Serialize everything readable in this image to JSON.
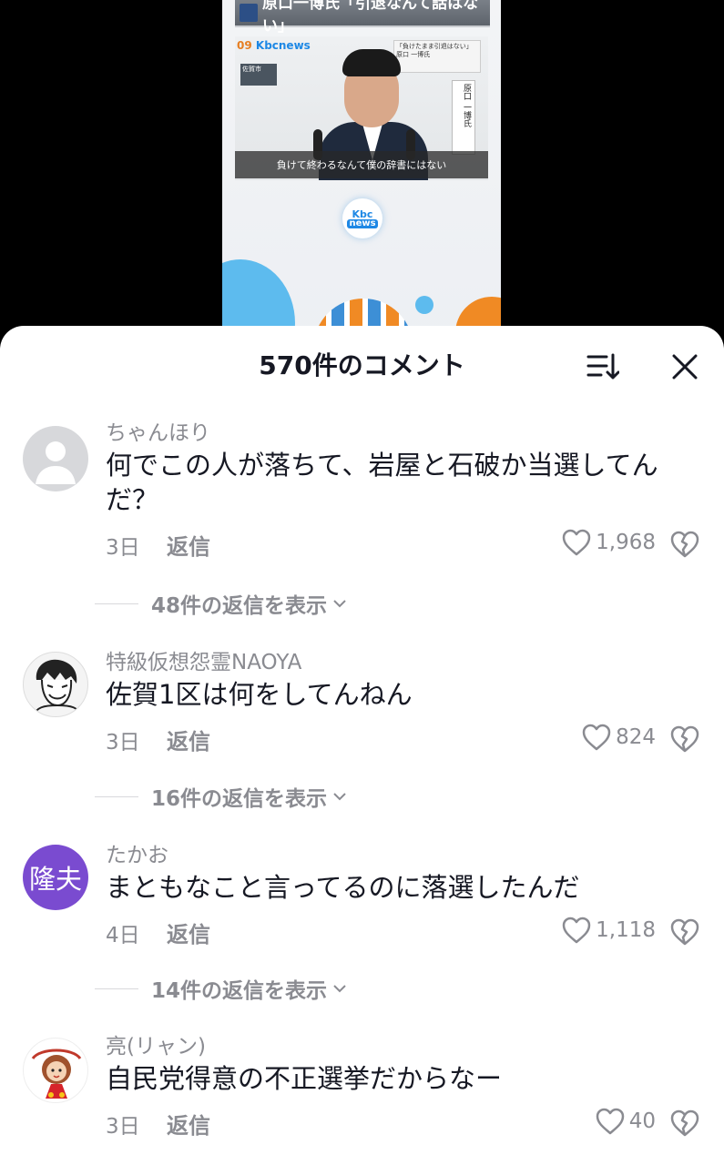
{
  "video": {
    "headline": "原口一博氏「引退なんて話はない」",
    "channel_num": "09",
    "channel_name": "Kbcnews",
    "caption_right": "「負けたまま引退はない」",
    "caption_right_sub": "原口 一博氏",
    "location": "佐賀市",
    "name_plate": "原口 一博氏",
    "subtitle": "負けて終わるなんて僕の辞書にはない",
    "logo_top": "Kbc",
    "logo_bottom": "news"
  },
  "sheet": {
    "title": "570件のコメント",
    "sort_icon": "sort-icon",
    "close_icon": "close-icon"
  },
  "comments": [
    {
      "username": "ちゃんほり",
      "avatar": "default-avatar",
      "text": "何でこの人が落ちて、岩屋と石破か当選してんだ？",
      "date": "3日",
      "reply_label": "返信",
      "likes": "1,968",
      "view_replies": "48件の返信を表示"
    },
    {
      "username": "特級仮想怨霊NAOYA",
      "avatar": "manga-avatar",
      "text": "佐賀1区は何をしてんねん",
      "date": "3日",
      "reply_label": "返信",
      "likes": "824",
      "view_replies": "16件の返信を表示"
    },
    {
      "username": "たかお",
      "avatar_text": "隆夫",
      "text": "まともなこと言ってるのに落選したんだ",
      "date": "4日",
      "reply_label": "返信",
      "likes": "1,118",
      "view_replies": "14件の返信を表示"
    },
    {
      "username": "亮(リャン)",
      "avatar": "character-avatar",
      "text": "自民党得意の不正選挙だからなー",
      "date": "3日",
      "reply_label": "返信",
      "likes": "40"
    }
  ]
}
